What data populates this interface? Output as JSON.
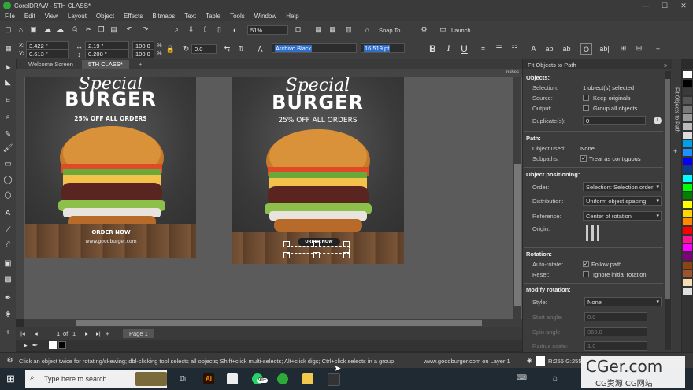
{
  "window": {
    "title": "CorelDRAW - 5TH CLASS*"
  },
  "menu": [
    "File",
    "Edit",
    "View",
    "Layout",
    "Object",
    "Effects",
    "Bitmaps",
    "Text",
    "Table",
    "Tools",
    "Window",
    "Help"
  ],
  "toolbar": {
    "zoom": "51%",
    "snap_to": "Snap To",
    "launch": "Launch"
  },
  "propbar": {
    "x": "3.422 \"",
    "y": "0.613 \"",
    "w": "2.19 \"",
    "h": "0.208 \"",
    "sx": "100.0",
    "sy": "100.0",
    "pct": "%",
    "angle": "0.0",
    "font": "Archivo Black",
    "size": "16.519 pt",
    "bold": "B",
    "italic": "I",
    "underline": "U"
  },
  "tabs": {
    "welcome": "Welcome Screen",
    "doc": "5TH CLASS*",
    "add": "+"
  },
  "ruler": {
    "unit": "inches"
  },
  "artwork": {
    "special": "Special",
    "burger": "BURGER",
    "offer": "25% OFF ALL ORDERS",
    "order": "ORDER NOW",
    "url": "www.goodburger.com"
  },
  "pagebar": {
    "first": "|◂",
    "prev": "◂",
    "current": "1",
    "of": "of",
    "total": "1",
    "next": "▸",
    "last": "▸|",
    "add": "+",
    "page": "Page 1"
  },
  "docker": {
    "title": "Fit Objects to Path",
    "vertical_tab": "Fit Objects to Path",
    "objects_header": "Objects:",
    "selection_label": "Selection:",
    "selection_value": "1 object(s) selected",
    "source_label": "Source:",
    "keep_originals": "Keep originals",
    "output_label": "Output:",
    "group_all": "Group all objects",
    "duplicates_label": "Duplicate(s):",
    "duplicates_value": "0",
    "path_header": "Path:",
    "object_used_label": "Object used:",
    "object_used_value": "None",
    "subpaths_label": "Subpaths:",
    "treat_contiguous": "Treat as contiguous",
    "positioning_header": "Object positioning:",
    "order_label": "Order:",
    "order_value": "Selection: Selection order",
    "distribution_label": "Distribution:",
    "distribution_value": "Uniform object spacing",
    "reference_label": "Reference:",
    "reference_value": "Center of rotation",
    "origin_label": "Origin:",
    "rotation_header": "Rotation:",
    "autorotate_label": "Auto-rotate:",
    "follow_path": "Follow path",
    "reset_label": "Reset:",
    "ignore_rotation": "Ignore initial rotation",
    "modify_header": "Modify rotation:",
    "style_label": "Style:",
    "style_value": "None",
    "start_angle_label": "Start angle:",
    "start_angle_value": "0.0",
    "spin_angle_label": "Spin angle:",
    "spin_angle_value": "360.0",
    "radius_label": "Radius scale:",
    "radius_value": "1.0"
  },
  "status": {
    "hint": "Click an object twice for rotating/skewing; dbl-clicking tool selects all objects; Shift+click multi-selects; Alt+click digs; Ctrl+click selects in a group",
    "layer": "www.goodburger.com on Layer 1",
    "color": "R:255 G:255"
  },
  "taskbar": {
    "search": "Type here to search",
    "badge": "99+"
  },
  "watermark": {
    "main": "CGer.com",
    "sub": "CG资源 CG网站"
  },
  "palette_colors": [
    "#ffffff",
    "#000000",
    "#3a3a3a",
    "#555555",
    "#777777",
    "#999999",
    "#bbbbbb",
    "#dddddd",
    "#00a0e9",
    "#1e90ff",
    "#0000ff",
    "#0a3d91",
    "#00ffff",
    "#00ff00",
    "#008000",
    "#ffff00",
    "#ffd700",
    "#ff8c00",
    "#ff0000",
    "#ff1493",
    "#ff00ff",
    "#800080",
    "#8b4513",
    "#a0522d",
    "#f5deb3",
    "#e0e0e0"
  ]
}
